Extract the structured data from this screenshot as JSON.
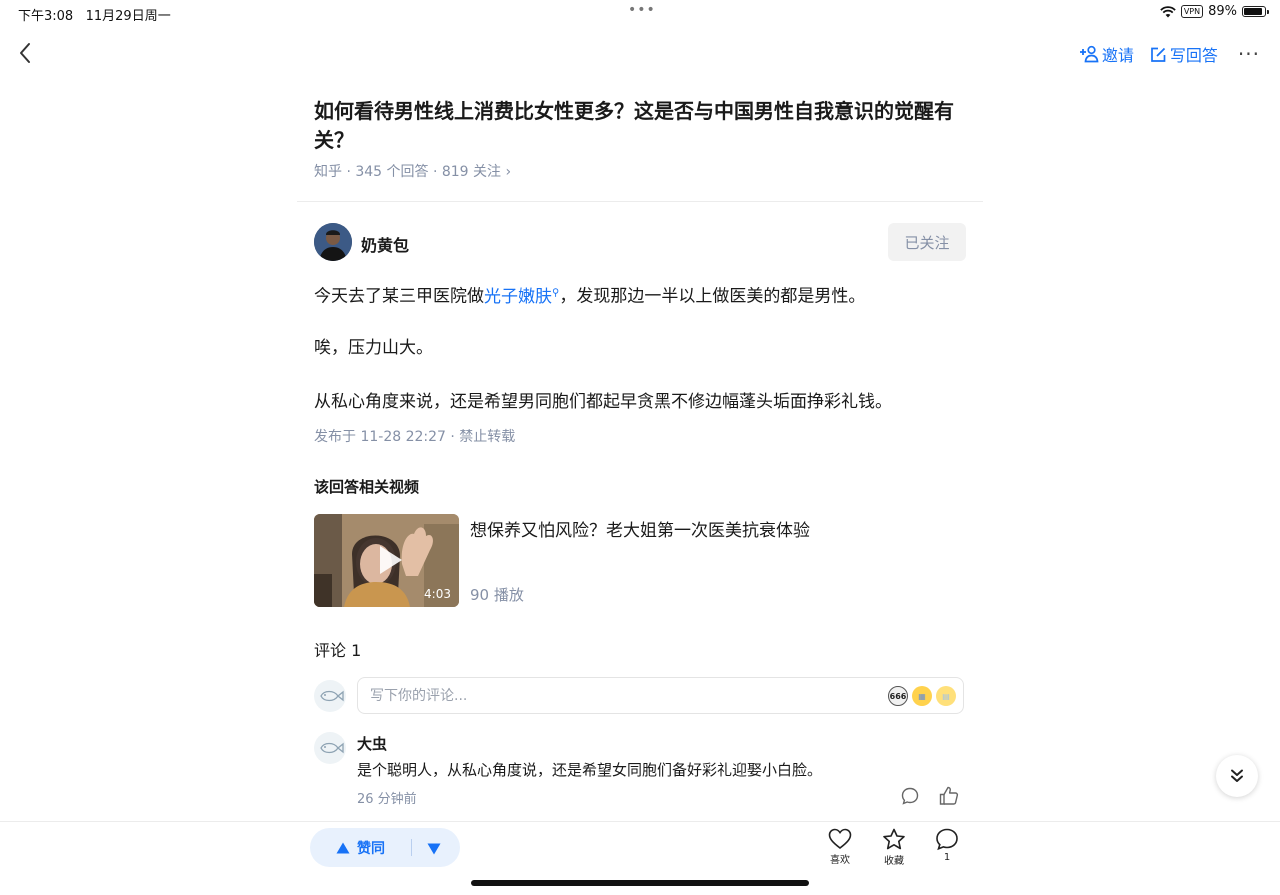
{
  "status_bar": {
    "time": "下午3:08",
    "date": "11月29日周一",
    "vpn": "VPN",
    "battery": "89%",
    "battery_level": 0.89
  },
  "top_nav": {
    "invite_label": "邀请",
    "write_answer_label": "写回答"
  },
  "question": {
    "title": "如何看待男性线上消费比女性更多？这是否与中国男性自我意识的觉醒有关？",
    "meta": "知乎 · 345 个回答 · 819 关注 ›"
  },
  "answer": {
    "author": "奶黄包",
    "follow_label": "已关注",
    "para1_before": "今天去了某三甲医院做",
    "para1_link": "光子嫩肤",
    "para1_after": "，发现那边一半以上做医美的都是男性。",
    "para2": "唉，压力山大。",
    "para3": "从私心角度来说，还是希望男同胞们都起早贪黑不修边幅蓬头垢面挣彩礼钱。",
    "meta": "发布于 11-28 22:27 · 禁止转载"
  },
  "related_video": {
    "section_title": "该回答相关视频",
    "title": "想保养又怕风险？老大姐第一次医美抗衰体验",
    "duration": "4:03",
    "plays": "90 播放"
  },
  "comments": {
    "header": "评论 1",
    "input_placeholder": "写下你的评论...",
    "items": [
      {
        "author": "大虫",
        "text": "是个聪明人，从私心角度说，还是希望女同胞们备好彩礼迎娶小白脸。",
        "time": "26 分钟前"
      }
    ]
  },
  "bottom_bar": {
    "vote_label": "赞同",
    "like_label": "喜欢",
    "collect_label": "收藏",
    "comment_count": "1"
  },
  "colors": {
    "accent": "#1772f6",
    "meta_gray": "#8590a6",
    "vote_bg": "#e8f1fd"
  }
}
